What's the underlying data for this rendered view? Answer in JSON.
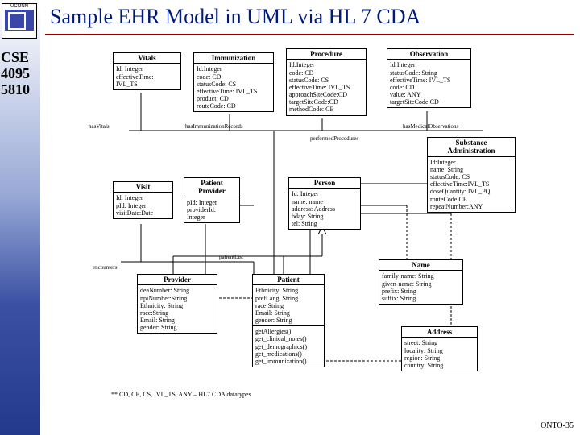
{
  "header": {
    "logo_text": "UCONN",
    "title": "Sample EHR Model in UML via HL 7 CDA"
  },
  "sidebar": {
    "course_code": "CSE\n4095\n5810"
  },
  "footer": {
    "slide_ref": "ONTO-35"
  },
  "diagram": {
    "footnote": "** CD, CE, CS, IVL_TS, ANY – HL7 CDA datatypes",
    "classes": {
      "vitals": {
        "name": "Vitals",
        "attrs": "Id: Integer\neffectiveTime:\nIVL_TS"
      },
      "immunization": {
        "name": "Immunization",
        "attrs": "Id:Integer\ncode: CD\nstatusCode: CS\neffectiveTime: IVL_TS\nproduct: CD\nrouteCode: CD"
      },
      "procedure": {
        "name": "Procedure",
        "attrs": "Id:Integer\ncode: CD\nstatusCode: CS\neffectiveTime: IVL_TS\napproachSiteCode:CD\ntargetSiteCode:CD\nmethodCode: CE"
      },
      "observation": {
        "name": "Observation",
        "attrs": "Id:Integer\nstatusCode: String\neffectiveTime: IVL_TS\ncode: CD\nvalue: ANY\ntargetSiteCode:CD"
      },
      "substance": {
        "name": "Substance\nAdministration",
        "attrs": "Id:Integer\nname: String\nstatusCode: CS\neffectiveTime:IVL_TS\ndoseQuantity: IVL_PQ\nrouteCode:CE\nrepeatNumber:ANY"
      },
      "visit": {
        "name": "Visit",
        "attrs": "Id: Integer\npId: Integer\nvisitDate:Date"
      },
      "patientprovider": {
        "name": "Patient\nProvider",
        "attrs": "pId: Integer\nproviderId:\nInteger"
      },
      "person": {
        "name": "Person",
        "attrs": "Id: Integer\nname: name\naddress: Address\nbday: String\ntel: String"
      },
      "provider": {
        "name": "Provider",
        "attrs": "deaNumber: String\nnpiNumber:String\nEthnicity: String\nrace:String\nEmail: String\ngender: String"
      },
      "patient": {
        "name": "Patient",
        "attrs": "Ethnicity: String\nprefLang: String\nrace:String\nEmail: String\ngender: String",
        "ops": "getAllergies()\nget_clinical_notes()\nget_demographics()\nget_medications()\nget_immunization()"
      },
      "name": {
        "name": "Name",
        "attrs": "family-name: String\ngiven-name: String\nprefix: String\nsuffix: String"
      },
      "address": {
        "name": "Address",
        "attrs": "street: String\nlocality: String\nregion: String\ncountry: String"
      }
    },
    "assoc": {
      "hasVitals": "hasVitals",
      "hasImmun": "hasImmunizationRecords",
      "performed": "performedProcedures",
      "hasObs": "hasMedicalObservations",
      "encounters": "encounters",
      "patientList": "patientList"
    }
  }
}
